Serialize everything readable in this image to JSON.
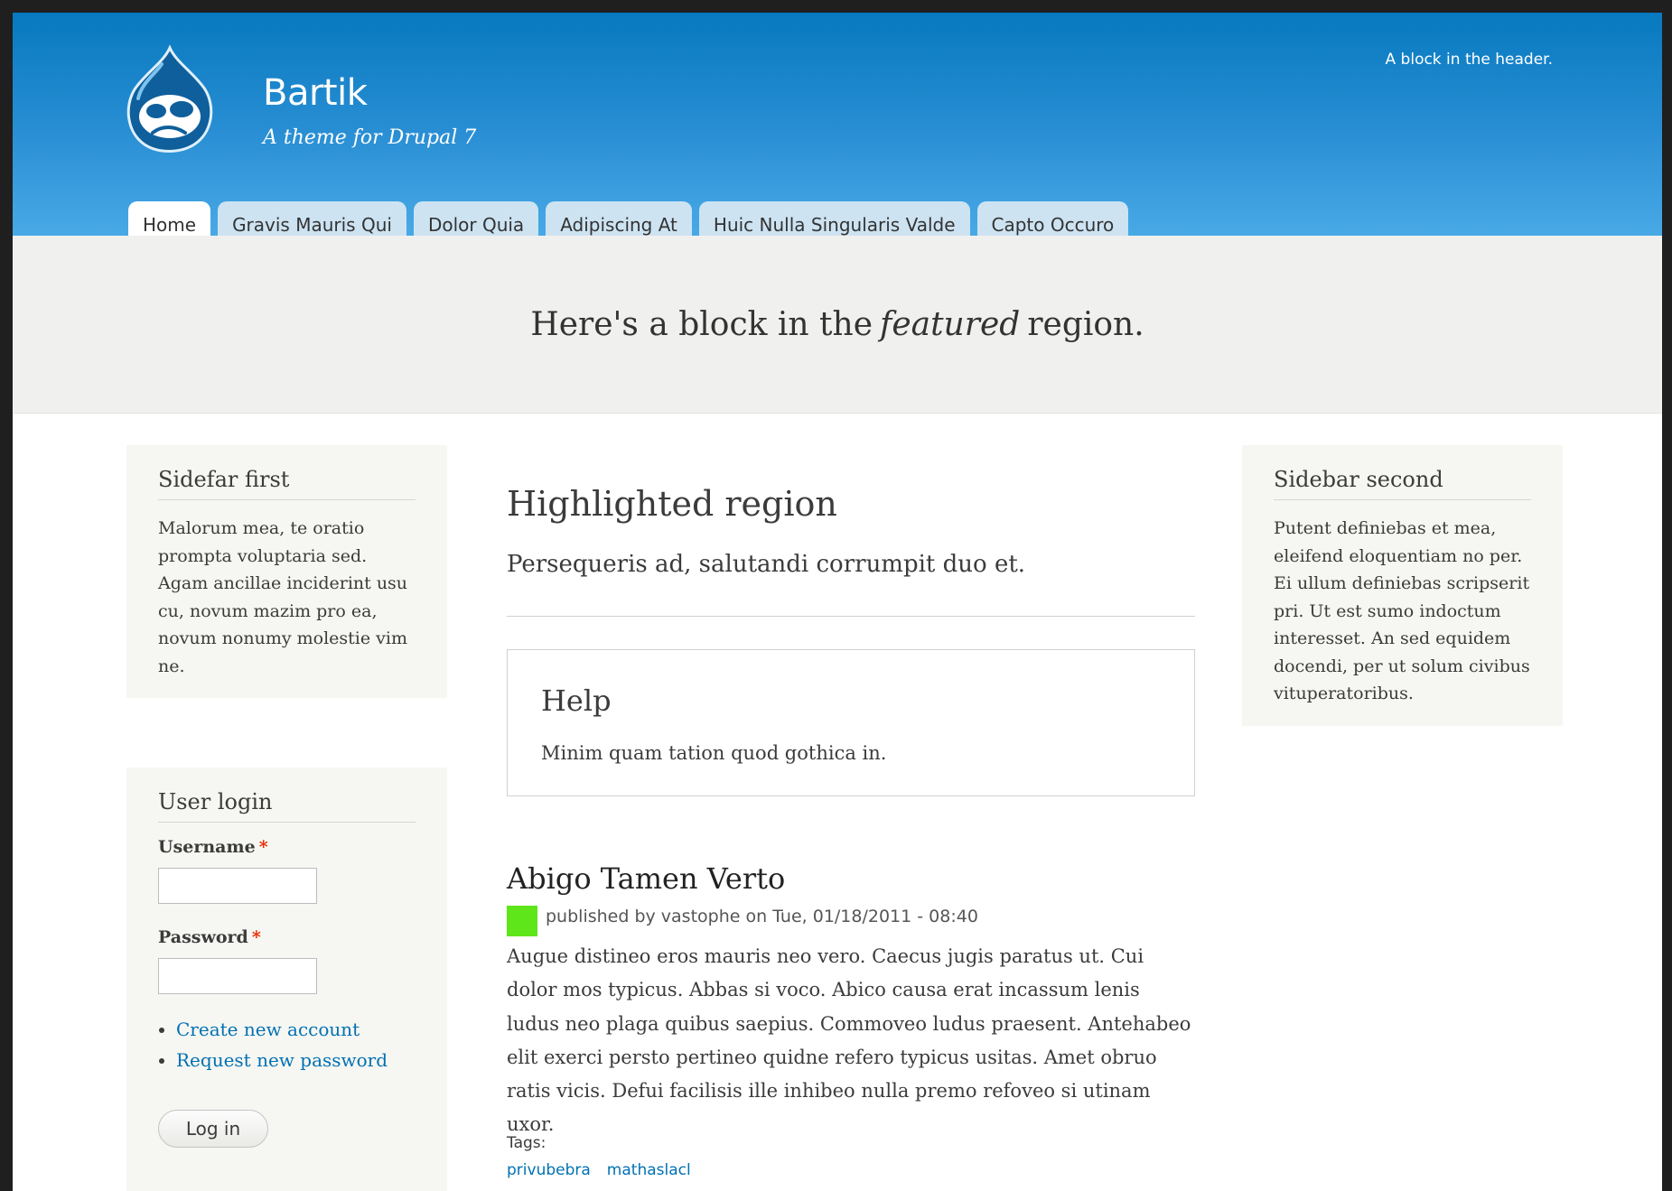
{
  "header": {
    "site_name": "Bartik",
    "site_slogan": "A theme for Drupal 7",
    "header_block": "A block in the header.",
    "logo_icon": "drupal-drop-logo",
    "gradient_top": "#0779bf",
    "gradient_bottom": "#48a9e6"
  },
  "nav": {
    "tabs": [
      {
        "label": "Home",
        "active": true
      },
      {
        "label": "Gravis Mauris Qui",
        "active": false
      },
      {
        "label": "Dolor Quia",
        "active": false
      },
      {
        "label": "Adipiscing At",
        "active": false
      },
      {
        "label": "Huic Nulla Singularis Valde",
        "active": false
      },
      {
        "label": "Capto Occuro",
        "active": false
      }
    ]
  },
  "featured": {
    "before": "Here's a block in the",
    "emphasis": "featured",
    "after": "region."
  },
  "sidebar_first": {
    "title": "Sidefar first",
    "text": "Malorum mea, te oratio prompta voluptaria sed. Agam ancillae inciderint usu cu, novum mazim pro ea, novum nonumy molestie vim ne."
  },
  "user_login": {
    "title": "User login",
    "username_label": "Username",
    "password_label": "Password",
    "required_marker": "*",
    "username_value": "",
    "password_value": "",
    "links": [
      "Create new account",
      "Request new password"
    ],
    "submit_label": "Log in"
  },
  "highlighted": {
    "title": "Highlighted region",
    "text": "Persequeris ad, salutandi corrumpit duo et."
  },
  "help": {
    "title": "Help",
    "text": "Minim quam tation quod gothica in."
  },
  "article": {
    "title": "Abigo Tamen Verto",
    "submitted": "published by vastophe on Tue, 01/18/2011 - 08:40",
    "body": "Augue distineo eros mauris neo vero. Caecus jugis paratus ut. Cui dolor mos typicus. Abbas si voco. Abico causa erat incassum lenis ludus neo plaga quibus saepius. Commoveo ludus praesent. Antehabeo elit exerci persto pertineo quidne refero typicus usitas. Amet obruo ratis vicis. Defui facilisis ille inhibeo nulla premo refoveo si utinam uxor.",
    "tags_label": "Tags:",
    "tags": [
      "privubebra",
      "mathaslacl"
    ],
    "author_picture_color": "#5ee61a"
  },
  "sidebar_second": {
    "title": "Sidebar second",
    "text": "Putent definiebas et mea, eleifend eloquentiam no per. Ei ullum definiebas scripserit pri. Ut est sumo indoctum interesset. An sed equidem docendi, per ut solum civibus vituperatoribus."
  },
  "colors": {
    "link": "#0071b3",
    "sidebar_bg": "#f6f6f2",
    "featured_bg": "#f0f0ee",
    "required": "#ea2800"
  }
}
